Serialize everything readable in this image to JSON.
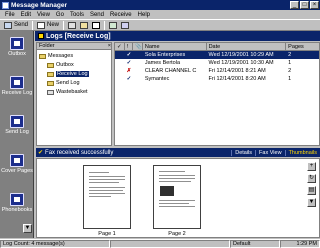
{
  "window": {
    "title": "Message Manager",
    "controls": [
      "_",
      "□",
      "×"
    ]
  },
  "menu": [
    "File",
    "Edit",
    "View",
    "Go",
    "Tools",
    "Send",
    "Receive",
    "Help"
  ],
  "toolbar": {
    "send_label": "Send",
    "new_label": "New"
  },
  "sidebar": {
    "items": [
      {
        "label": "Outbox",
        "icon": "outbox-icon"
      },
      {
        "label": "Receive Log",
        "icon": "receive-log-icon"
      },
      {
        "label": "Send Log",
        "icon": "send-log-icon"
      },
      {
        "label": "Cover Pages",
        "icon": "cover-pages-icon"
      },
      {
        "label": "Phonebooks",
        "icon": "phonebooks-icon"
      }
    ]
  },
  "header": {
    "title": "Logs [Receive Log]"
  },
  "folders": {
    "heading": "Folder",
    "close": "×",
    "items": [
      {
        "label": "Messages"
      },
      {
        "label": "Outbox"
      },
      {
        "label": "Receive Log"
      },
      {
        "label": "Send Log"
      },
      {
        "label": "Wastebasket"
      }
    ]
  },
  "list": {
    "columns": [
      "✓",
      "!",
      "📎",
      "Name",
      "Date",
      "Pages"
    ],
    "rows": [
      {
        "mark": "✓",
        "name": "Sola Enterprises",
        "date": "Wed 12/19/2001 10:29 AM",
        "pages": "2"
      },
      {
        "mark": "✓",
        "name": "James Bertola",
        "date": "Wed 12/19/2001 10:30 AM",
        "pages": "1"
      },
      {
        "mark": "✗",
        "name": "CLEAR CHANNEL C",
        "date": "Fri 12/14/2001 8:21 AM",
        "pages": "2"
      },
      {
        "mark": "✓",
        "name": "Symantec",
        "date": "Fri 12/14/2001 8:20 AM",
        "pages": "1"
      }
    ]
  },
  "preview": {
    "status": "Fax received successfully",
    "tabs": [
      "Details",
      "Fax View",
      "Thumbnails"
    ],
    "pages": [
      {
        "label": "Page 1"
      },
      {
        "label": "Page 2"
      }
    ]
  },
  "statusbar": {
    "log_count": "Log Count: 4 message(s)",
    "default": "Default",
    "time": "1:29 PM"
  },
  "colors": {
    "title_blue": "#0a246a",
    "thumbnails_tab": "#ffd800"
  }
}
